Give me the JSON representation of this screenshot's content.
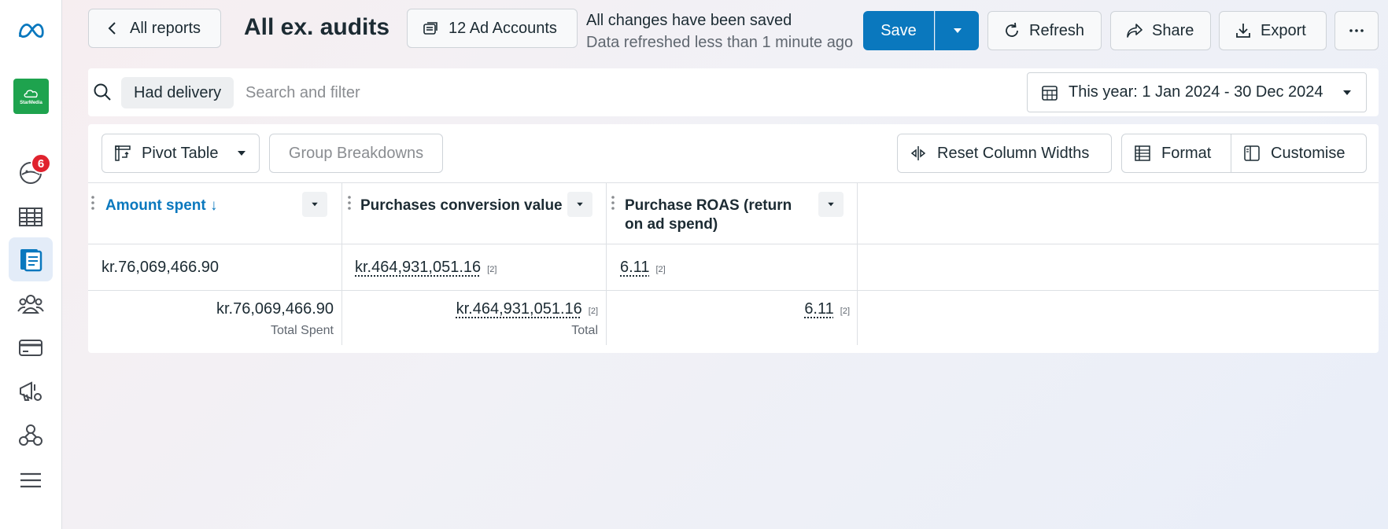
{
  "header": {
    "back_label": "All reports",
    "title": "All ex. audits",
    "accounts_label": "12 Ad Accounts",
    "status_saved": "All changes have been saved",
    "status_refreshed": "Data refreshed less than 1 minute ago",
    "save_label": "Save",
    "refresh_label": "Refresh",
    "share_label": "Share",
    "export_label": "Export"
  },
  "sidebar": {
    "notification_count": "6",
    "brand_text": "StarMedia",
    "items": [
      "meta-logo",
      "account-avatar",
      "notifications",
      "table",
      "reports",
      "audiences",
      "billing",
      "campaigns",
      "events",
      "menu"
    ]
  },
  "filter": {
    "chip_label": "Had delivery",
    "search_placeholder": "Search and filter",
    "date_range_label": "This year: 1 Jan 2024 - 30 Dec 2024"
  },
  "toolbar": {
    "pivot_label": "Pivot Table",
    "group_label": "Group Breakdowns",
    "reset_label": "Reset Column Widths",
    "format_label": "Format",
    "customise_label": "Customise"
  },
  "table": {
    "columns": [
      {
        "label": "Amount spent",
        "sort_arrow": "↓"
      },
      {
        "label": "Purchases conversion value"
      },
      {
        "label_line1": "Purchase ROAS (return",
        "label_line2": "on ad spend)"
      }
    ],
    "row": {
      "amount": "kr.76,069,466.90",
      "conversion_value": "kr.464,931,051.16",
      "conversion_foot": "[2]",
      "roas": "6.11",
      "roas_foot": "[2]"
    },
    "total": {
      "amount": "kr.76,069,466.90",
      "amount_label": "Total Spent",
      "conversion_value": "kr.464,931,051.16",
      "conversion_foot": "[2]",
      "conversion_label": "Total",
      "roas": "6.11",
      "roas_foot": "[2]"
    }
  },
  "colors": {
    "accent": "#0a78be",
    "badge": "#e0222e",
    "brand": "#1ea34e"
  }
}
